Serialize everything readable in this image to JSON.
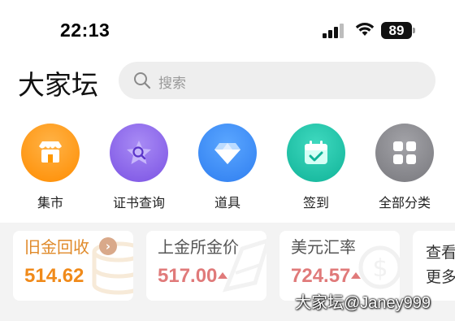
{
  "status": {
    "time": "22:13",
    "battery": "89",
    "icons": [
      "signal-icon",
      "wifi-icon",
      "battery-icon"
    ]
  },
  "header": {
    "logo": "大家坛",
    "search_placeholder": "搜索",
    "search_icon": "search-icon"
  },
  "shortcuts": [
    {
      "label": "集市",
      "icon": "store-icon",
      "color": "#ff9800"
    },
    {
      "label": "证书查询",
      "icon": "certificate-search-icon",
      "color": "#8a63ea"
    },
    {
      "label": "道具",
      "icon": "diamond-icon",
      "color": "#3c8cf5"
    },
    {
      "label": "签到",
      "icon": "calendar-check-icon",
      "color": "#18c3a8"
    },
    {
      "label": "全部分类",
      "icon": "grid-icon",
      "color": "#8a8a8e"
    }
  ],
  "cards": [
    {
      "title": "旧金回收",
      "value": "514.62",
      "value_color": "#f08a1a",
      "trend": "",
      "title_color": "#e08a2a"
    },
    {
      "title": "上金所金价",
      "value": "517.00",
      "value_color": "#e07a7a",
      "trend": "up"
    },
    {
      "title": "美元汇率",
      "value": "724.57",
      "value_color": "#e07a7a",
      "trend": "up"
    },
    {
      "title": "查看",
      "value": "更多",
      "value_color": "#333333",
      "trend": ""
    }
  ],
  "watermark": "大家坛@Janey999"
}
